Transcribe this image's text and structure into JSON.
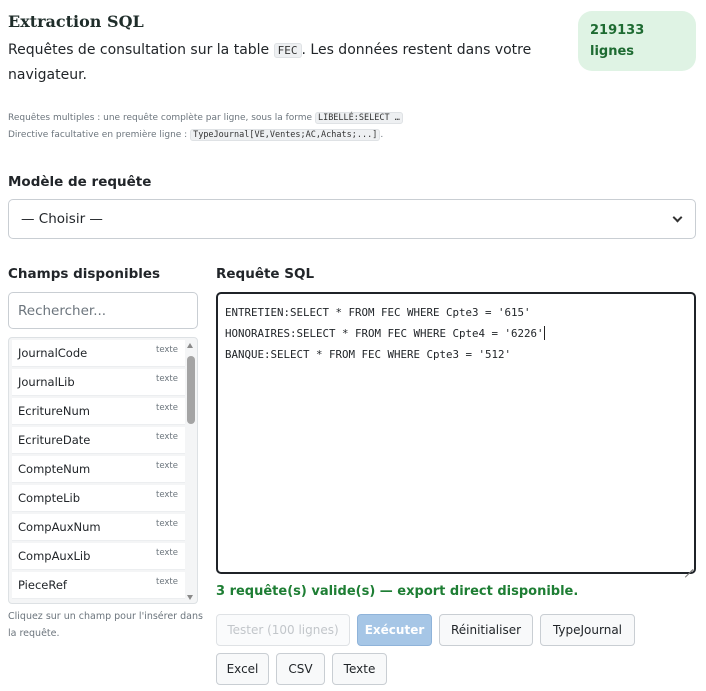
{
  "header": {
    "title": "Extraction SQL",
    "subtitle_pre": "Requêtes de consultation sur la table ",
    "subtitle_code": "FEC",
    "subtitle_post": ". Les données restent dans votre navigateur.",
    "row_count": "219133",
    "row_unit": "lignes"
  },
  "help": {
    "line1_pre": "Requêtes multiples : une requête complète par ligne, sous la forme ",
    "line1_code": "LIBELLÉ:SELECT …",
    "line2_pre": "Directive facultative en première ligne : ",
    "line2_code": "TypeJournal[VE,Ventes;AC,Achats;...]",
    "line2_post": "."
  },
  "template": {
    "label": "Modèle de requête",
    "selected": "— Choisir —"
  },
  "fields": {
    "label": "Champs disponibles",
    "search_placeholder": "Rechercher...",
    "items": [
      {
        "name": "JournalCode",
        "type": "texte"
      },
      {
        "name": "JournalLib",
        "type": "texte"
      },
      {
        "name": "EcritureNum",
        "type": "texte"
      },
      {
        "name": "EcritureDate",
        "type": "texte"
      },
      {
        "name": "CompteNum",
        "type": "texte"
      },
      {
        "name": "CompteLib",
        "type": "texte"
      },
      {
        "name": "CompAuxNum",
        "type": "texte"
      },
      {
        "name": "CompAuxLib",
        "type": "texte"
      },
      {
        "name": "PieceRef",
        "type": "texte"
      }
    ],
    "hint": "Cliquez sur un champ pour l'insérer dans la requête."
  },
  "sql": {
    "label": "Requête SQL",
    "lines": [
      "ENTRETIEN:SELECT * FROM FEC WHERE Cpte3 = '615'",
      "HONORAIRES:SELECT * FROM FEC WHERE Cpte4 = '6226'",
      "BANQUE:SELECT * FROM FEC WHERE Cpte3 = '512'"
    ],
    "status": "3 requête(s) valide(s) — export direct disponible."
  },
  "actions": {
    "test": "Tester (100 lignes)",
    "execute": "Exécuter",
    "reset": "Réinitialiser",
    "type_journal": "TypeJournal",
    "excel": "Excel",
    "csv": "CSV",
    "text": "Texte"
  },
  "colors": {
    "badge_bg": "#dff3e4",
    "badge_text": "#1e6b32",
    "status_green": "#1e7e34",
    "primary_disabled": "#a6c6e6"
  }
}
